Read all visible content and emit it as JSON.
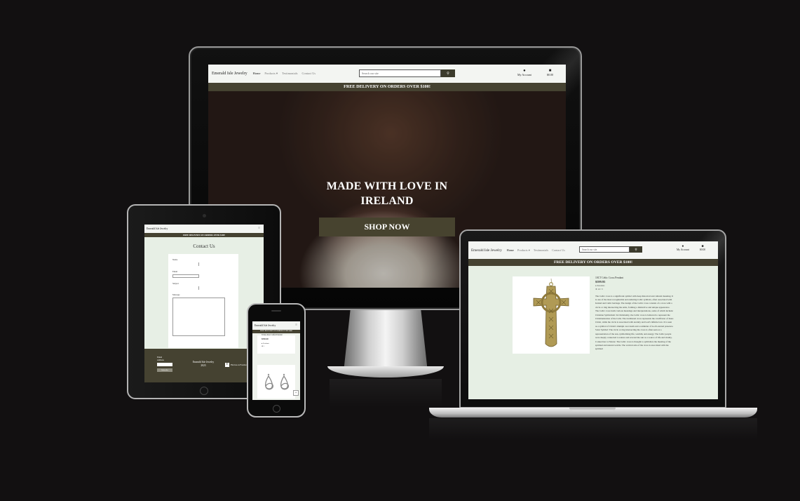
{
  "site": {
    "logo": "Emerald Isle Jewelry",
    "nav": [
      "Home",
      "Products",
      "Testimonials",
      "Contact Us"
    ],
    "search_placeholder": "Search our site",
    "account_label": "My Account",
    "cart_total": "$0.00",
    "banner": "FREE DELIVERY ON ORDERS OVER $100!",
    "colors": {
      "header_bg": "#f3f5f2",
      "banner_bg": "#454231",
      "accent": "#3c3b2c",
      "page_bg": "#e7efe5"
    }
  },
  "desktop": {
    "hero_title": "MADE WITH LOVE IN IRELAND",
    "hero_button": "SHOP NOW"
  },
  "tablet": {
    "page_title": "Contact Us",
    "labels": {
      "name": "Name",
      "email": "Email",
      "subject": "Subject",
      "message": "Message"
    },
    "submit": "Submit",
    "footer": {
      "email_label": "Email Address",
      "subscribe": "Subscribe",
      "brand_line": "Emerald Isle Jewelry",
      "year": "2023",
      "social": "Find us on Facebook"
    }
  },
  "phone": {
    "product_title": "Trinity Knot Cuffed Pendant",
    "price": "$550.00",
    "category": "Pendants",
    "rating": "5"
  },
  "laptop": {
    "product_name": "10CT Celtic Cross Pendant",
    "price": "$599.95",
    "category": "Pendants",
    "rating": "4.9 / 5",
    "description": "The Celtic cross is a significant symbol with deep historical and cultural meaning. It is one of the most recognizable and enduring Celtic symbols, often associated with Ireland and Celtic heritage. The design of the Celtic cross consists of a cross with a circle or ring intersecting the arms, forming a distinctive and unique appearance. The Celtic cross holds various meanings and interpretations, some of which include: Christian Symbolism: In Christianity, the Celtic cross is believed to represent the Christianization of the Celts. The traditional cross represents the crucifixion of Jesus Christ, while the circle is associated with eternity and God's infinite love. It is seen as a symbol of Christ's triumph over death and a reminder of God's eternal presence. Solar Symbol: The circle or ring intersecting the cross is often seen as a representation of the sun, symbolizing life, warmth, and energy. The Celtic people were deeply connected to nature and revered the sun as a source of life and vitality. Connection to Nature: The Celtic cross is thought to symbolize the meeting of the spiritual and natural worlds. The vertical axis of the cross is associated with the spiritual"
  }
}
